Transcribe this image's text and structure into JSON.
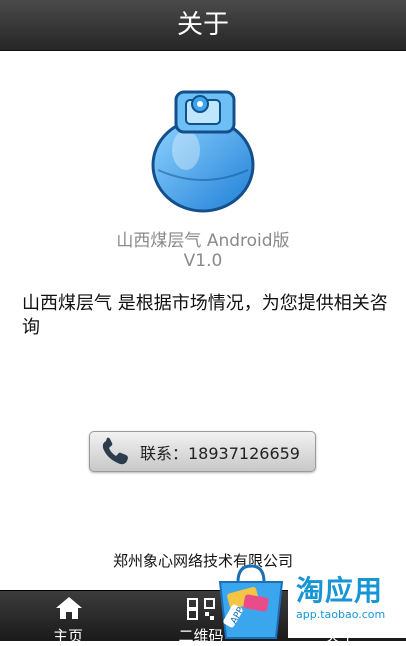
{
  "header": {
    "title": "关于"
  },
  "app": {
    "name": "山西煤层气 Android版",
    "version": "V1.0",
    "description": "山西煤层气 是根据市场情况，为您提供相关咨询"
  },
  "contact": {
    "label": "联系：18937126659"
  },
  "footer": {
    "company": "郑州象心网络技术有限公司"
  },
  "tabs": [
    {
      "label": "主页"
    },
    {
      "label": "二维码"
    },
    {
      "label": "关于"
    }
  ],
  "overlay_badge": {
    "title": "淘应用",
    "url": "app.taobao.com",
    "tag": "APP"
  },
  "colors": {
    "bar_dark": "#262626",
    "text_gray": "#8a8a8a",
    "logo_blue": "#3aa6ee",
    "badge_blue": "#1796d6"
  }
}
